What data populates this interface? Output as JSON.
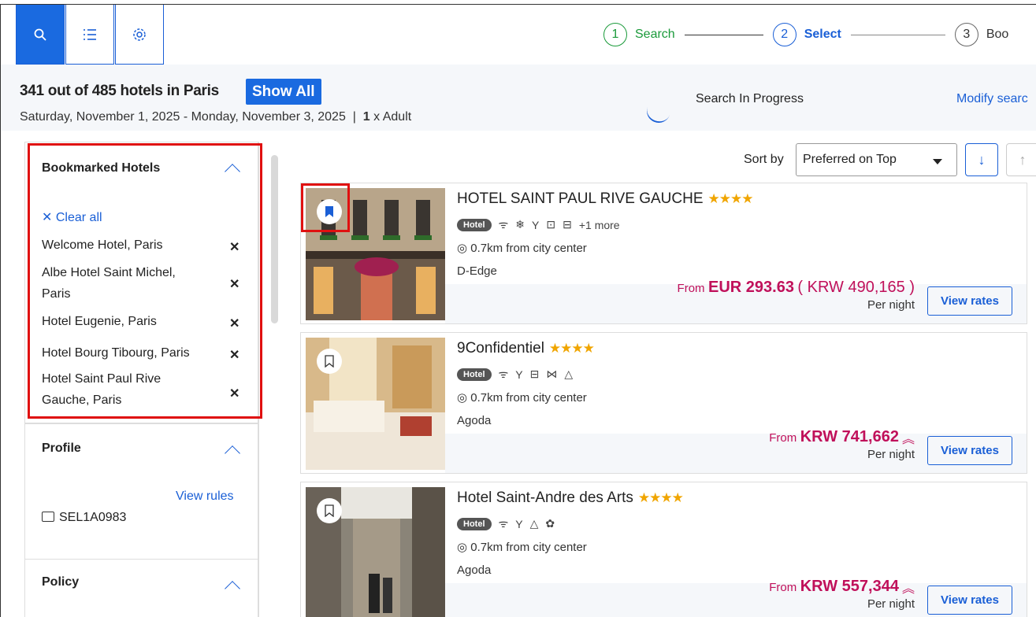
{
  "steps": [
    {
      "num": "1",
      "label": "Search"
    },
    {
      "num": "2",
      "label": "Select"
    },
    {
      "num": "3",
      "label": "Boo"
    }
  ],
  "header": {
    "count": "341 out of 485 hotels in Paris",
    "show_all": "Show All",
    "date_range": "Saturday, November 1, 2025  - Monday, November 3, 2025",
    "separator": "|",
    "guests_bold": "1",
    "guests_text": "x Adult",
    "progress": "Search In Progress",
    "modify": "Modify searc"
  },
  "sidebar": {
    "bookmarked": {
      "title": "Bookmarked Hotels",
      "clear": "Clear all",
      "items": [
        "Welcome Hotel, Paris",
        "Albe Hotel Saint Michel, Paris",
        "Hotel Eugenie, Paris",
        "Hotel Bourg Tibourg, Paris",
        "Hotel Saint Paul Rive Gauche, Paris"
      ]
    },
    "profile": {
      "title": "Profile",
      "view_rules": "View rules",
      "code": "SEL1A0983"
    },
    "policy": {
      "title": "Policy"
    }
  },
  "sort": {
    "label": "Sort by",
    "value": "Preferred on Top"
  },
  "hotels": [
    {
      "name": "HOTEL SAINT PAUL RIVE GAUCHE",
      "stars": "★★★★",
      "badge": "Hotel",
      "more": "+1 more",
      "distance": "0.7km from city center",
      "source": "D-Edge",
      "from": "From",
      "price": "EUR 293.63",
      "price2": "( KRW 490,165 )",
      "per": "Per night",
      "view": "View rates"
    },
    {
      "name": "9Confidentiel",
      "stars": "★★★★",
      "badge": "Hotel",
      "distance": "0.7km from city center",
      "source": "Agoda",
      "from": "From",
      "price": "KRW 741,662",
      "per": "Per night",
      "view": "View rates"
    },
    {
      "name": "Hotel Saint-Andre des Arts",
      "stars": "★★★★",
      "badge": "Hotel",
      "distance": "0.7km from city center",
      "source": "Agoda",
      "from": "From",
      "price": "KRW 557,344",
      "per": "Per night",
      "view": "View rates"
    }
  ],
  "colors": {
    "primary": "#1a6ae0",
    "price": "#c0105a",
    "highlight": "#e01010",
    "stars": "#f0a500"
  }
}
